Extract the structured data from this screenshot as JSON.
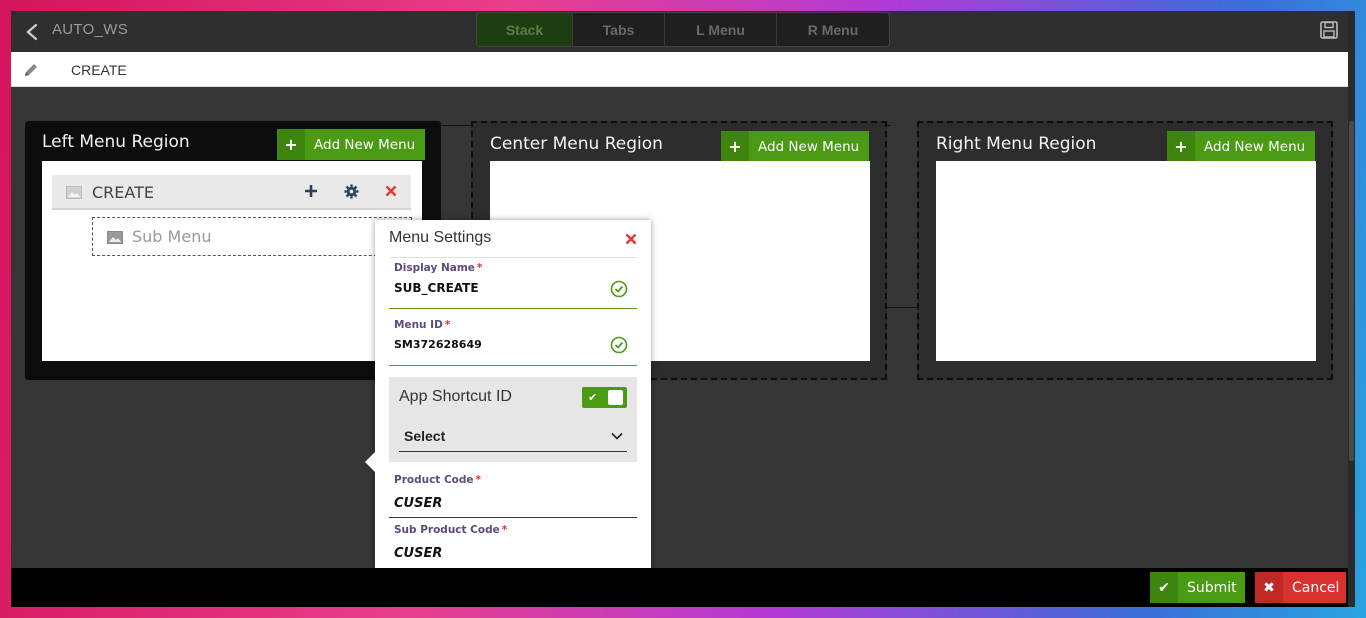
{
  "header": {
    "app_title": "AUTO_WS",
    "layout_tabs": [
      {
        "label": "Stack",
        "active": true
      },
      {
        "label": "Tabs",
        "active": false
      },
      {
        "label": "L Menu",
        "active": false
      },
      {
        "label": "R Menu",
        "active": false
      }
    ]
  },
  "breadcrumb": {
    "current": "CREATE"
  },
  "regions": {
    "left": {
      "title": "Left Menu Region",
      "add_label": "Add New Menu"
    },
    "center": {
      "title": "Center Menu Region",
      "add_label": "Add New Menu"
    },
    "right": {
      "title": "Right Menu Region",
      "add_label": "Add New Menu"
    }
  },
  "menu_tree": {
    "root_label": "CREATE",
    "sub_label": "Sub Menu"
  },
  "menu_settings": {
    "title": "Menu Settings",
    "display_name": {
      "label": "Display Name",
      "value": "SUB_CREATE",
      "required_mark": "*"
    },
    "menu_id": {
      "label": "Menu ID",
      "value": "SM372628649",
      "required_mark": "*"
    },
    "app_shortcut": {
      "label": "App Shortcut ID",
      "enabled": true,
      "select_value": "Select"
    },
    "product_code": {
      "label": "Product Code",
      "value": "CUSER",
      "required_mark": "*"
    },
    "sub_product_code": {
      "label": "Sub Product Code",
      "value": "CUSER",
      "required_mark": "*"
    }
  },
  "footer": {
    "submit_label": "Submit",
    "cancel_label": "Cancel"
  },
  "colors": {
    "accent_green": "#4a9a14",
    "danger_red": "#d9312f",
    "field_label_purple": "#5c4a7a"
  },
  "icons": [
    "back-icon",
    "save-icon",
    "pencil-icon",
    "plus-icon",
    "image-icon",
    "gear-icon",
    "close-icon",
    "check-circle-icon",
    "chevron-down-icon",
    "checkmark-icon"
  ]
}
